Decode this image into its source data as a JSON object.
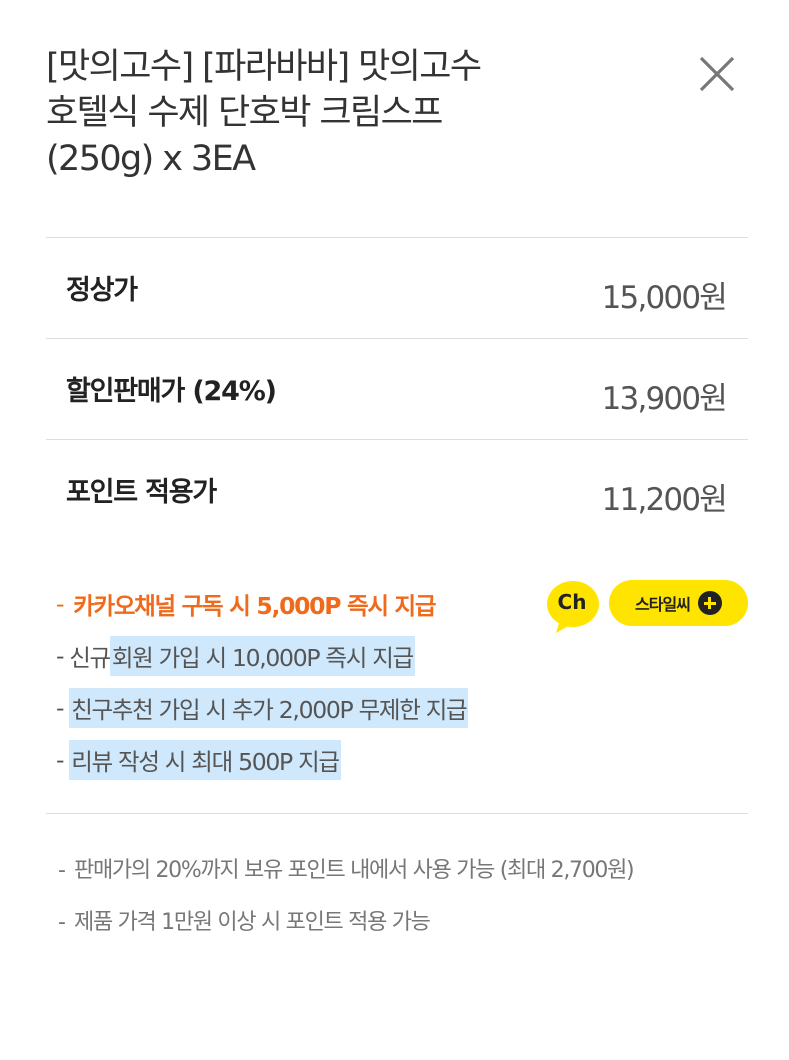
{
  "product": {
    "title_lines": [
      "[맛의고수] [파라바바] 맛의고수",
      "호텔식 수제 단호박 크림스프",
      "(250g) x 3EA"
    ]
  },
  "close_icon": "close-x-icon",
  "prices": [
    {
      "label": "정상가",
      "value": "15,000원"
    },
    {
      "label": "할인판매가 (24%)",
      "value": "13,900원"
    },
    {
      "label": "포인트 적용가",
      "value": "11,200원"
    }
  ],
  "benefits": {
    "dash": "-",
    "kakao": "카카오채널 구독 시 5,000P 즉시 지급",
    "ch_label": "Ch",
    "style_button": "스타일씨",
    "signup_pre": "신규",
    "signup_hl": "회원 가입 시 10,000P 즉시 지급",
    "referral": "친구추천 가입 시 추가 2,000P 무제한 지급",
    "review": "리뷰 작성 시 최대 500P 지급"
  },
  "notes": {
    "dash": "-",
    "note1": "판매가의 20%까지 보유 포인트 내에서 사용 가능 (최대 2,700원)",
    "note2": "제품 가격 1만원 이상 시 포인트 적용 가능"
  },
  "colors": {
    "accent_orange": "#ef6a1a",
    "kakao_yellow": "#ffe400",
    "highlight_blue": "#cfe8fb"
  }
}
